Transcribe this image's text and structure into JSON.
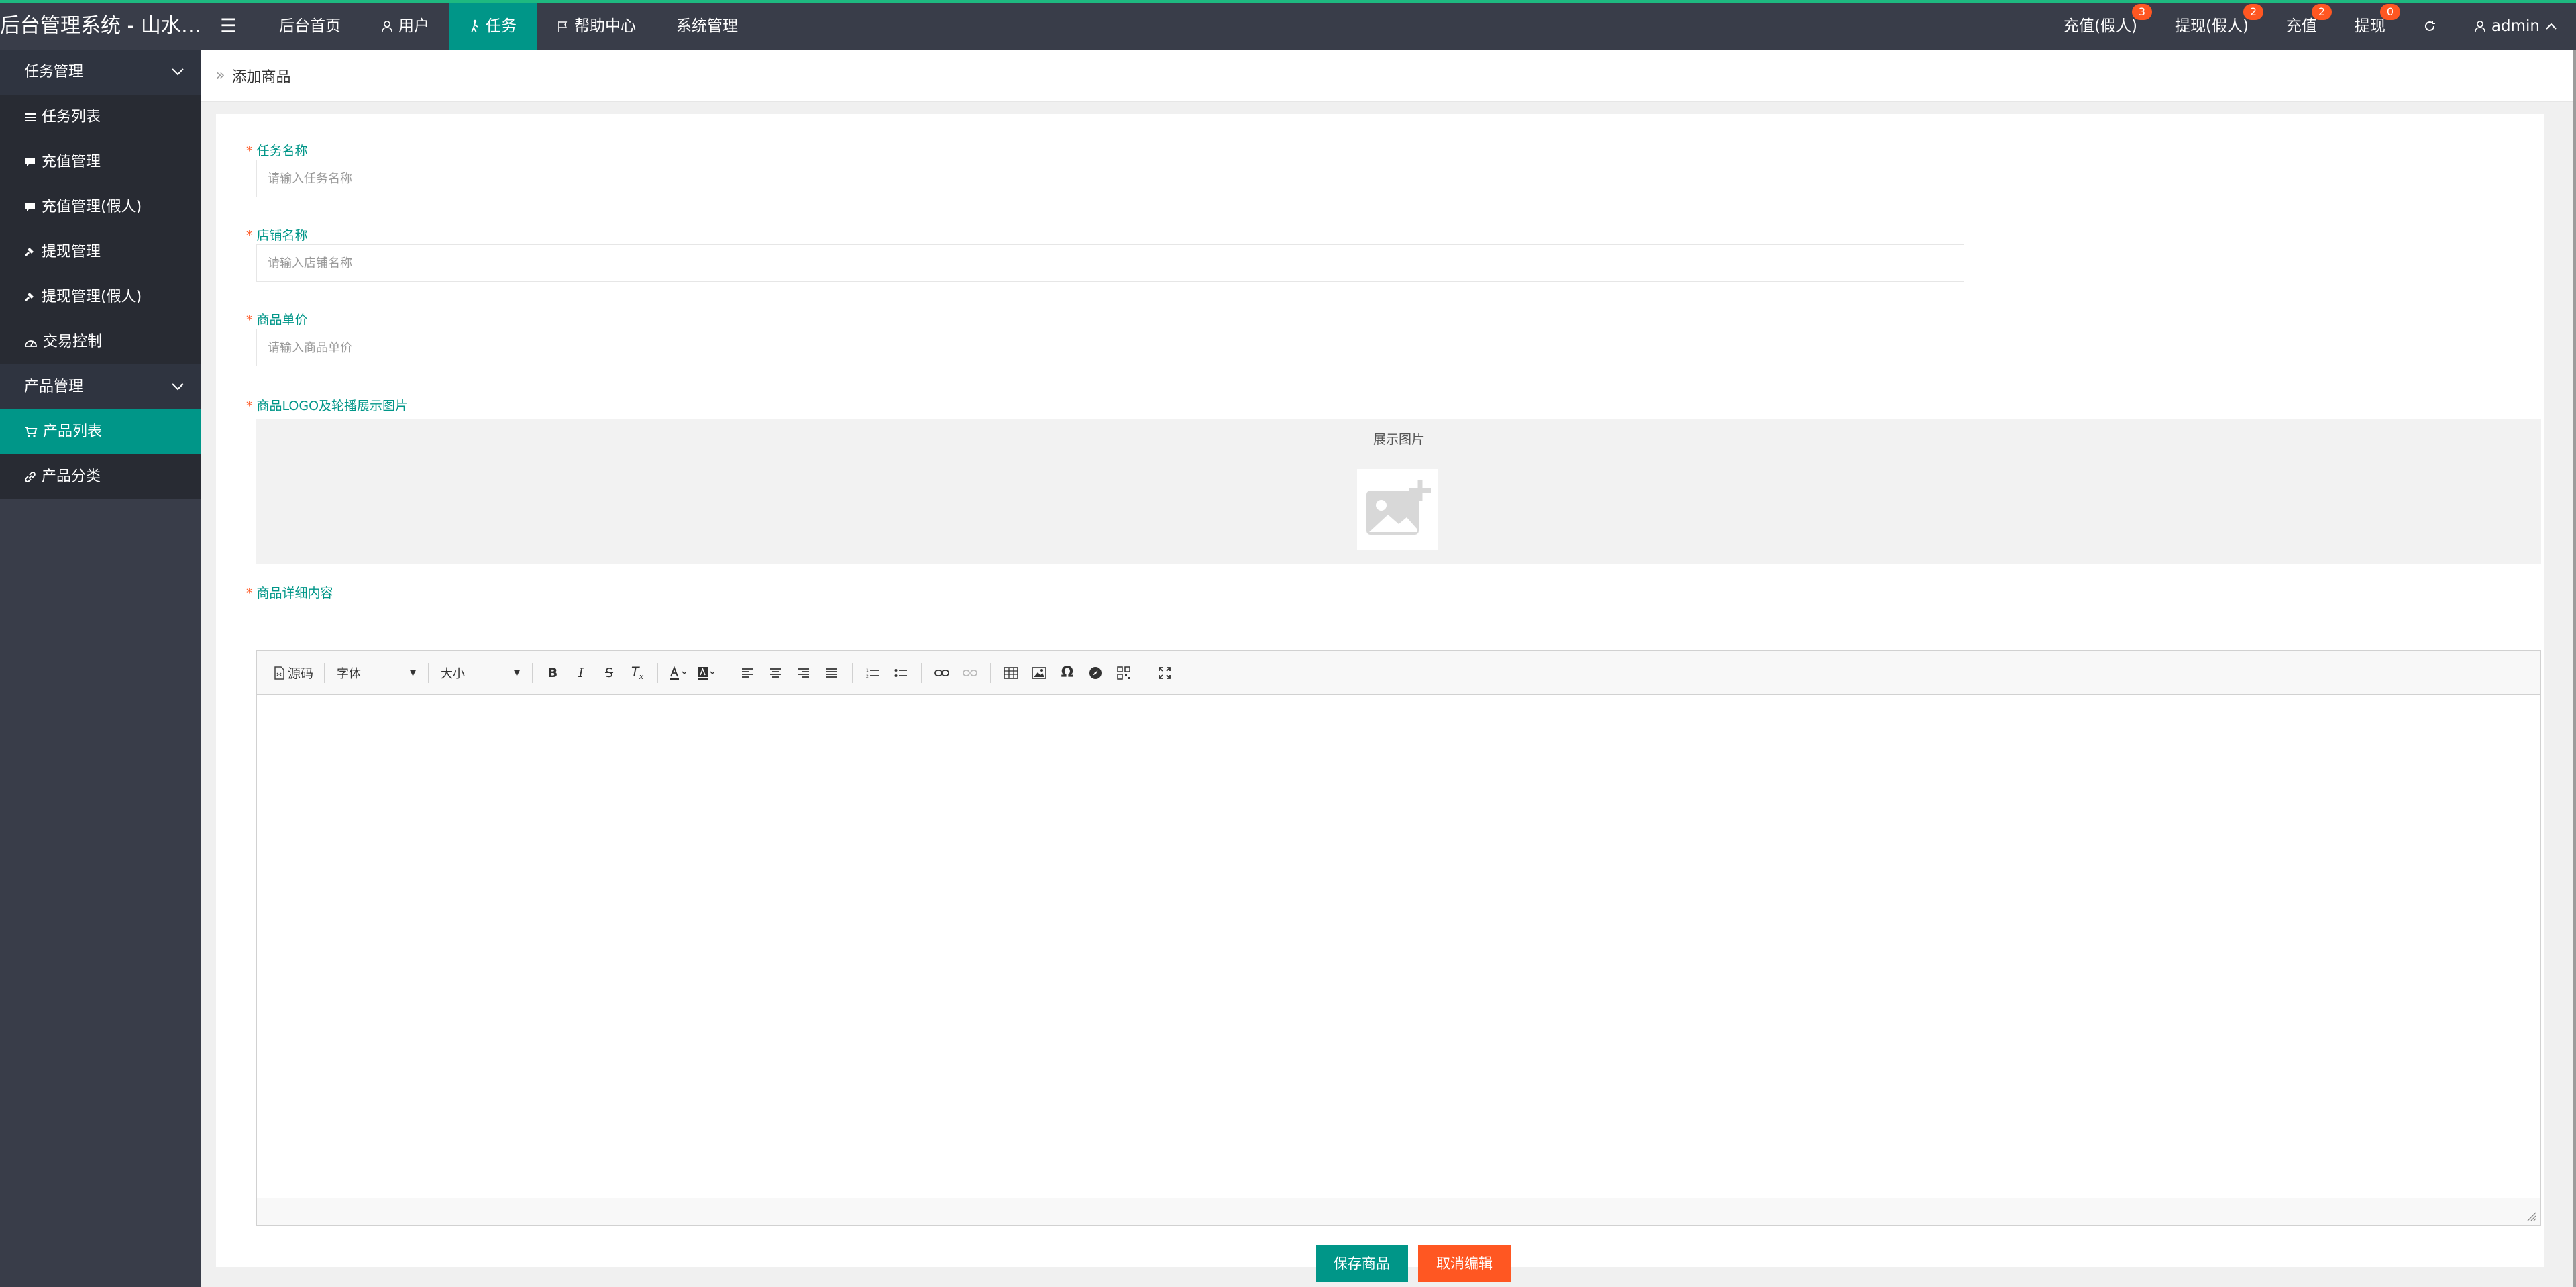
{
  "header": {
    "brand": "后台管理系统 - 山水资...",
    "nav": [
      {
        "label": "后台首页",
        "icon": ""
      },
      {
        "label": "用户",
        "icon": "user-icon"
      },
      {
        "label": "任务",
        "icon": "walk-icon",
        "active": true
      },
      {
        "label": "帮助中心",
        "icon": "flag-icon"
      },
      {
        "label": "系统管理",
        "icon": ""
      }
    ],
    "right": [
      {
        "label": "充值(假人)",
        "badge": "3"
      },
      {
        "label": "提现(假人)",
        "badge": "2"
      },
      {
        "label": "充值",
        "badge": "2"
      },
      {
        "label": "提现",
        "badge": "0"
      }
    ],
    "user": "admin"
  },
  "sidebar": {
    "group1": "任务管理",
    "items1": [
      "任务列表",
      "充值管理",
      "充值管理(假人)",
      "提现管理",
      "提现管理(假人)",
      "交易控制"
    ],
    "group2": "产品管理",
    "items2": [
      "产品列表",
      "产品分类"
    ],
    "active": "产品列表"
  },
  "breadcrumb": {
    "current": "添加商品"
  },
  "form": {
    "task_name": {
      "label": "任务名称",
      "placeholder": "请输入任务名称"
    },
    "shop_name": {
      "label": "店铺名称",
      "placeholder": "请输入店铺名称"
    },
    "unit_price": {
      "label": "商品单价",
      "placeholder": "请输入商品单价"
    },
    "logo": {
      "label": "商品LOGO及轮播展示图片",
      "upload_title": "展示图片"
    },
    "detail": {
      "label": "商品详细内容"
    }
  },
  "editor": {
    "source_label": "源码",
    "font_label": "字体",
    "size_label": "大小"
  },
  "buttons": {
    "save": "保存商品",
    "cancel": "取消编辑"
  },
  "colors": {
    "accent": "#009688",
    "danger": "#ff5722",
    "topbar": "#393d49"
  }
}
